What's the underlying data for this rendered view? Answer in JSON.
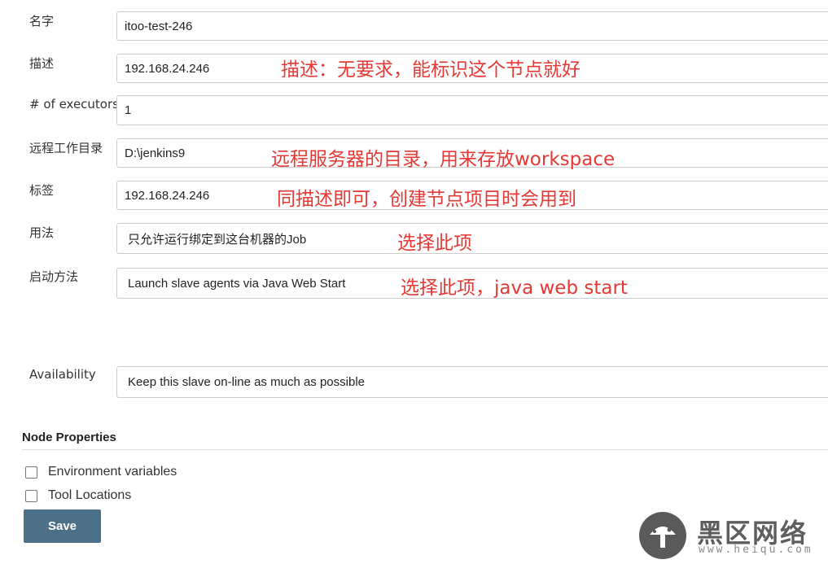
{
  "form": {
    "fields": [
      {
        "label": "名字",
        "value": "itoo-test-246"
      },
      {
        "label": "描述",
        "value": "192.168.24.246"
      },
      {
        "label": "# of executors",
        "value": "1"
      },
      {
        "label": "远程工作目录",
        "value": "D:\\jenkins9"
      },
      {
        "label": "标签",
        "value": "192.168.24.246"
      },
      {
        "label": "用法",
        "value": "只允许运行绑定到这台机器的Job"
      },
      {
        "label": "启动方法",
        "value": "Launch slave agents via Java Web Start"
      },
      {
        "label": "Availability",
        "value": "Keep this slave on-line as much as possible"
      }
    ]
  },
  "annotations": {
    "description": "描述：无要求，能标识这个节点就好",
    "remote_dir": "远程服务器的目录，用来存放workspace",
    "labels": "同描述即可，创建节点项目时会用到",
    "usage": "选择此项",
    "launch": "选择此项，java web start",
    "color": "#e53935"
  },
  "node_properties": {
    "title": "Node Properties",
    "options": [
      {
        "label": "Environment variables",
        "checked": false
      },
      {
        "label": "Tool Locations",
        "checked": false
      }
    ]
  },
  "save_label": "Save",
  "watermark": {
    "text": "黑区网络",
    "url": "www.heiqu.com"
  },
  "colors": {
    "save_button": "#4c7088",
    "annotation": "#e53935"
  }
}
